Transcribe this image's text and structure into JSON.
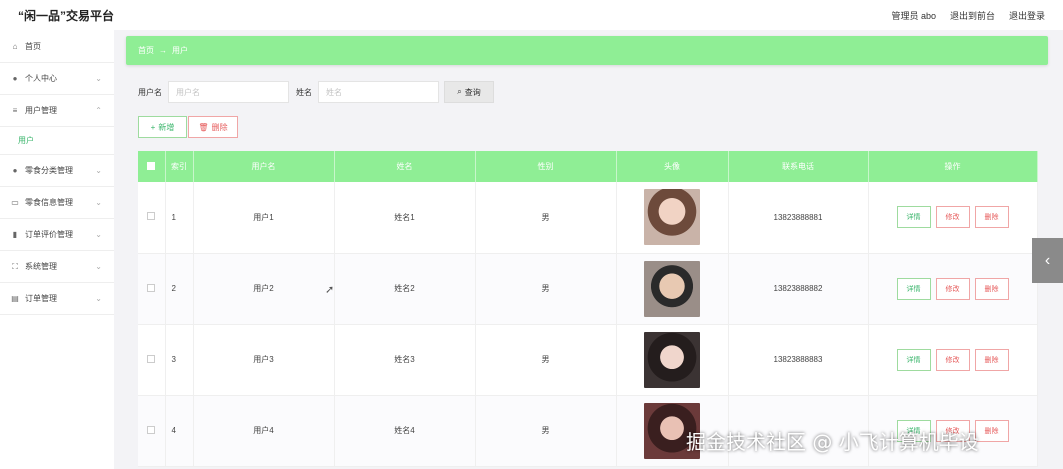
{
  "app": {
    "title": "“闲一品”交易平台"
  },
  "topbar": {
    "admin_label": "管理员 abo",
    "back_front": "退出到前台",
    "logout": "退出登录"
  },
  "sidebar": {
    "items": [
      {
        "label": "首页",
        "icon": "home-icon"
      },
      {
        "label": "个人中心",
        "icon": "user-icon"
      },
      {
        "label": "用户管理",
        "icon": "list-icon"
      },
      {
        "label": "零食分类管理",
        "icon": "user-icon"
      },
      {
        "label": "零食信息管理",
        "icon": "store-icon"
      },
      {
        "label": "订单评价管理",
        "icon": "chart-icon"
      },
      {
        "label": "系统管理",
        "icon": "frame-icon"
      },
      {
        "label": "订单管理",
        "icon": "trash-icon"
      }
    ],
    "sub_active": "用户"
  },
  "breadcrumb": {
    "home": "首页",
    "arrow": "→",
    "current": "用户"
  },
  "search": {
    "username_label": "用户名",
    "username_placeholder": "用户名",
    "name_label": "姓名",
    "name_placeholder": "姓名",
    "query_label": "查询"
  },
  "actions": {
    "add_label": "新增",
    "delete_label": "删除"
  },
  "table": {
    "headers": [
      "索引",
      "用户名",
      "姓名",
      "性别",
      "头像",
      "联系电话",
      "操作"
    ],
    "rows": [
      {
        "index": "1",
        "username": "用户1",
        "name": "姓名1",
        "gender": "男",
        "phone": "13823888881"
      },
      {
        "index": "2",
        "username": "用户2",
        "name": "姓名2",
        "gender": "男",
        "phone": "13823888882"
      },
      {
        "index": "3",
        "username": "用户3",
        "name": "姓名3",
        "gender": "男",
        "phone": "13823888883"
      },
      {
        "index": "4",
        "username": "用户4",
        "name": "姓名4",
        "gender": "男",
        "phone": ""
      }
    ],
    "op_labels": {
      "detail": "详情",
      "edit": "修改",
      "remove": "删除"
    }
  },
  "watermark": "掘金技术社区 @ 小飞计算机毕设",
  "colors": {
    "accent": "#8fee95",
    "success_text": "#3ab56b",
    "danger_text": "#e65b5b"
  }
}
